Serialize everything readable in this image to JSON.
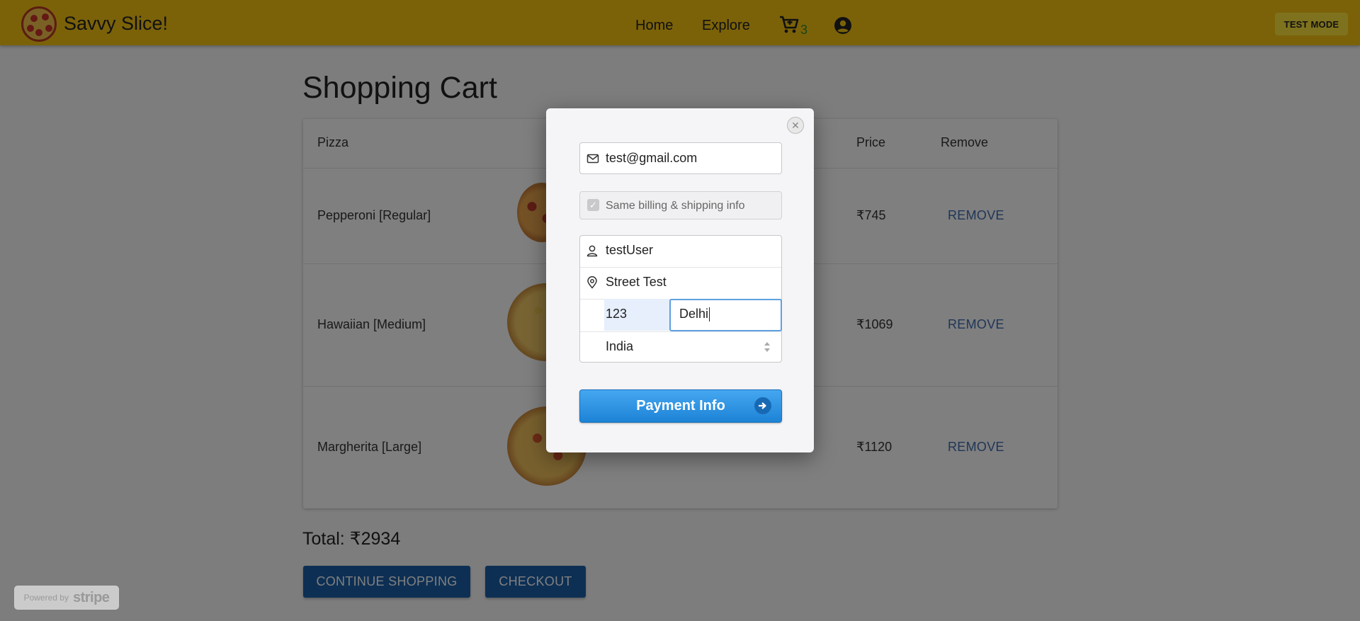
{
  "header": {
    "brand": "Savvy Slice!",
    "nav": {
      "home": "Home",
      "explore": "Explore"
    },
    "cart_count": "3",
    "test_mode": "TEST MODE"
  },
  "cart": {
    "title": "Shopping Cart",
    "columns": {
      "pizza": "Pizza",
      "price": "Price",
      "remove": "Remove"
    },
    "items": [
      {
        "name": "Pepperoni [Regular]",
        "price": "₹745",
        "remove": "REMOVE"
      },
      {
        "name": "Hawaiian [Medium]",
        "price": "₹1069",
        "remove": "REMOVE"
      },
      {
        "name": "Margherita [Large]",
        "price": "₹1120",
        "remove": "REMOVE"
      }
    ],
    "total": "Total: ₹2934",
    "continue_label": "CONTINUE SHOPPING",
    "checkout_label": "CHECKOUT"
  },
  "stripe_badge": {
    "powered_by": "Powered by",
    "brand": "stripe"
  },
  "modal": {
    "email": "test@gmail.com",
    "same_billing_label": "Same billing & shipping info",
    "name": "testUser",
    "street": "Street Test",
    "zip": "123",
    "city": "Delhi",
    "country": "India",
    "pay_label": "Payment Info"
  },
  "colors": {
    "header": "#f6c413",
    "test_mode": "#ffe43d",
    "primary_button": "#1a5fa8",
    "remove_link": "#3f6cb0",
    "pay_button": "#2a92e0"
  }
}
